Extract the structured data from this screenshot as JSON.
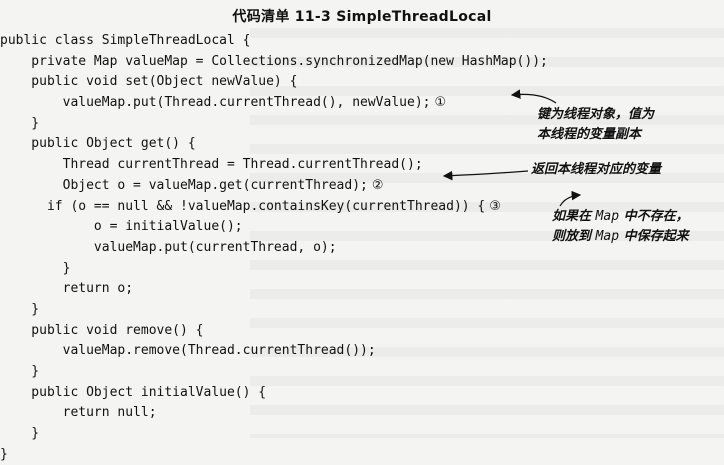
{
  "title": "代码清单 11-3   SimpleThreadLocal",
  "code_lines": [
    "public class SimpleThreadLocal {",
    "    private Map valueMap = Collections.synchronizedMap(new HashMap());",
    "    public void set(Object newValue) {",
    "        valueMap.put(Thread.currentThread(), newValue);",
    "    }",
    "    public Object get() {",
    "        Thread currentThread = Thread.currentThread();",
    "        Object o = valueMap.get(currentThread);",
    "      if (o == null && !valueMap.containsKey(currentThread)) {",
    "            o = initialValue();",
    "            valueMap.put(currentThread, o);",
    "        }",
    "        return o;",
    "    }",
    "    public void remove() {",
    "        valueMap.remove(Thread.currentThread());",
    "    }",
    "    public Object initialValue() {",
    "        return null;",
    "    }",
    "}"
  ],
  "markers": {
    "m1": "①",
    "m2": "②",
    "m3": "③"
  },
  "annotations": {
    "a1_line1": "键为线程对象，值为",
    "a1_line2": "本线程的变量副本",
    "a2_line1": "返回本线程对应的变量",
    "a3_line1_pre": "如果在",
    "a3_line1_code": "Map",
    "a3_line1_post": "中不存在，",
    "a3_line2_pre": "则放到",
    "a3_line2_code": "Map",
    "a3_line2_post": "中保存起来"
  }
}
